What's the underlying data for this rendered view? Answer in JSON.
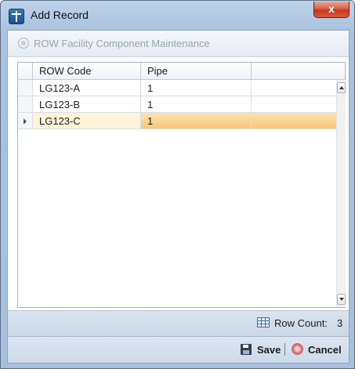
{
  "window": {
    "title": "Add Record",
    "close_symbol": "x",
    "icon": "app-record-icon"
  },
  "group": {
    "title": "ROW Facility Component Maintenance",
    "icon": "radio-circle-icon"
  },
  "grid": {
    "columns": [
      "ROW Code",
      "Pipe"
    ],
    "rows": [
      {
        "code": "LG123-A",
        "pipe": "1"
      },
      {
        "code": "LG123-B",
        "pipe": "1"
      },
      {
        "code": "LG123-C",
        "pipe": "1"
      }
    ],
    "current_row_index": 2
  },
  "footer": {
    "row_count_label": "Row Count:",
    "row_count_value": "3",
    "icon": "grid-table-icon"
  },
  "actions": {
    "save_label": "Save",
    "cancel_label": "Cancel",
    "save_icon": "floppy-disk-icon",
    "cancel_icon": "cancel-circle-icon"
  },
  "colors": {
    "selected_row": "#f8c774",
    "title_bar": "#bfd3ea",
    "close_button": "#c7371d"
  }
}
